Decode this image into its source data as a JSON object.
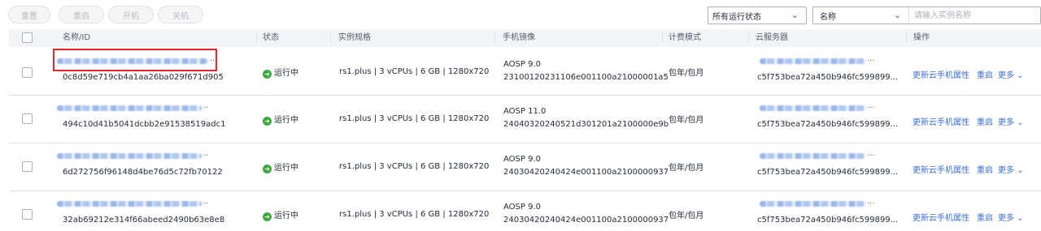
{
  "toolbar": {
    "reset_label": "重置",
    "restart_label": "重启",
    "power_on_label": "开机",
    "power_off_label": "关机",
    "status_filter": "所有运行状态",
    "search_field": "名称",
    "search_placeholder": "请输入实例名称"
  },
  "table": {
    "headers": {
      "name_id": "名称/ID",
      "status": "状态",
      "spec": "实例规格",
      "image": "手机镜像",
      "billing": "计费模式",
      "server": "云服务器",
      "actions": "操作"
    },
    "rows": [
      {
        "id": "0c8d59e719cb4a1aa26ba029f671d905",
        "status": "运行中",
        "spec": "rs1.plus | 3 vCPUs | 6 GB | 1280x720",
        "image_name": "AOSP 9.0",
        "image_id": "23100120231106e001100a21000001a5",
        "billing": "包年/包月",
        "server_id": "c5f753bea72a450b946fc599899...",
        "action_update": "更新云手机属性",
        "action_restart": "重启",
        "action_more": "更多"
      },
      {
        "id": "494c10d41b5041dcbb2e91538519adc1",
        "status": "运行中",
        "spec": "rs1.plus | 3 vCPUs | 6 GB | 1280x720",
        "image_name": "AOSP 11.0",
        "image_id": "24040320240521d301201a2100000e9b",
        "billing": "包年/包月",
        "server_id": "c5f753bea72a450b946fc599899...",
        "action_update": "更新云手机属性",
        "action_restart": "重启",
        "action_more": "更多"
      },
      {
        "id": "6d272756f96148d4be76d5c72fb70122",
        "status": "运行中",
        "spec": "rs1.plus | 3 vCPUs | 6 GB | 1280x720",
        "image_name": "AOSP 9.0",
        "image_id": "24030420240424e001100a2100000937",
        "billing": "包年/包月",
        "server_id": "c5f753bea72a450b946fc599899...",
        "action_update": "更新云手机属性",
        "action_restart": "重启",
        "action_more": "更多"
      },
      {
        "id": "32ab69212e314f66abeed2490b63e8e8",
        "status": "运行中",
        "spec": "rs1.plus | 3 vCPUs | 6 GB | 1280x720",
        "image_name": "AOSP 9.0",
        "image_id": "24030420240424e001100a2100000937",
        "billing": "包年/包月",
        "server_id": "c5f753bea72a450b946fc599899...",
        "action_update": "更新云手机属性",
        "action_restart": "重启",
        "action_more": "更多"
      }
    ]
  },
  "colors": {
    "link": "#3a6fd8",
    "running": "#3fa93f",
    "highlight": "#e3252c"
  }
}
